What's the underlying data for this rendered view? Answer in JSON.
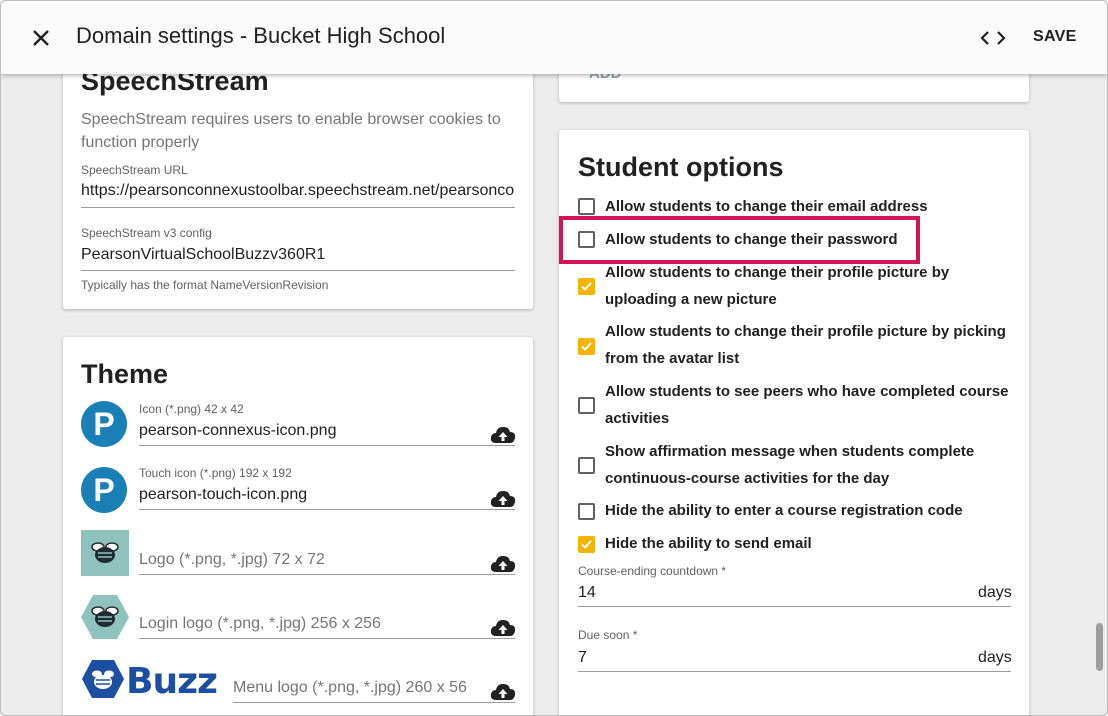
{
  "header": {
    "title": "Domain settings - Bucket High School",
    "save_label": "SAVE"
  },
  "top_right_card": {
    "add_label": "ADD"
  },
  "speechstream": {
    "heading": "SpeechStream",
    "description_line1": "SpeechStream requires users to enable browser cookies to",
    "description_line2": "function properly",
    "url_label": "SpeechStream URL",
    "url_value": "https://pearsonconnexustoolbar.speechstream.net/pearsonco",
    "config_label": "SpeechStream v3 config",
    "config_value": "PearsonVirtualSchoolBuzzv360R1",
    "config_hint": "Typically has the format NameVersionRevision"
  },
  "theme": {
    "heading": "Theme",
    "icon_label": "Icon (*.png) 42 x 42",
    "icon_value": "pearson-connexus-icon.png",
    "touch_label": "Touch icon (*.png) 192 x 192",
    "touch_value": "pearson-touch-icon.png",
    "logo_placeholder": "Logo (*.png, *.jpg) 72 x 72",
    "login_logo_placeholder": "Login logo (*.png, *.jpg) 256 x 256",
    "menu_logo_placeholder": "Menu logo (*.png, *.jpg) 260 x 56",
    "menu_logo_text": "Buzz",
    "pearson_letter": "P"
  },
  "student_options": {
    "heading": "Student options",
    "options": [
      {
        "label": "Allow students to change their email address",
        "checked": false
      },
      {
        "label": "Allow students to change their password",
        "checked": false
      },
      {
        "label_line1": "Allow students to change their profile picture by",
        "label_line2": "uploading a new picture",
        "checked": true
      },
      {
        "label_line1": "Allow students to change their profile picture by picking",
        "label_line2": "from the avatar list",
        "checked": true
      },
      {
        "label_line1": "Allow students to see peers who have completed course",
        "label_line2": "activities",
        "checked": false
      },
      {
        "label_line1": "Show affirmation message when students complete",
        "label_line2": "continuous-course activities for the day",
        "checked": false
      },
      {
        "label": "Hide the ability to enter a course registration code",
        "checked": false
      },
      {
        "label": "Hide the ability to send email",
        "checked": true
      }
    ],
    "countdown_label": "Course-ending countdown *",
    "countdown_value": "14",
    "countdown_unit": "days",
    "due_soon_label": "Due soon *",
    "due_soon_value": "7",
    "due_soon_unit": "days"
  },
  "colors": {
    "accent": "#f5b400",
    "highlight": "#d4145a",
    "pearson_blue": "#1a7fb5",
    "buzz_blue": "#1c4fa1",
    "logo_bg": "#8fc1bd"
  },
  "icons": [
    "close-icon",
    "code-icon",
    "upload-icon",
    "checkbox-icon",
    "pearson-logo-icon",
    "bee-logo-icon"
  ]
}
